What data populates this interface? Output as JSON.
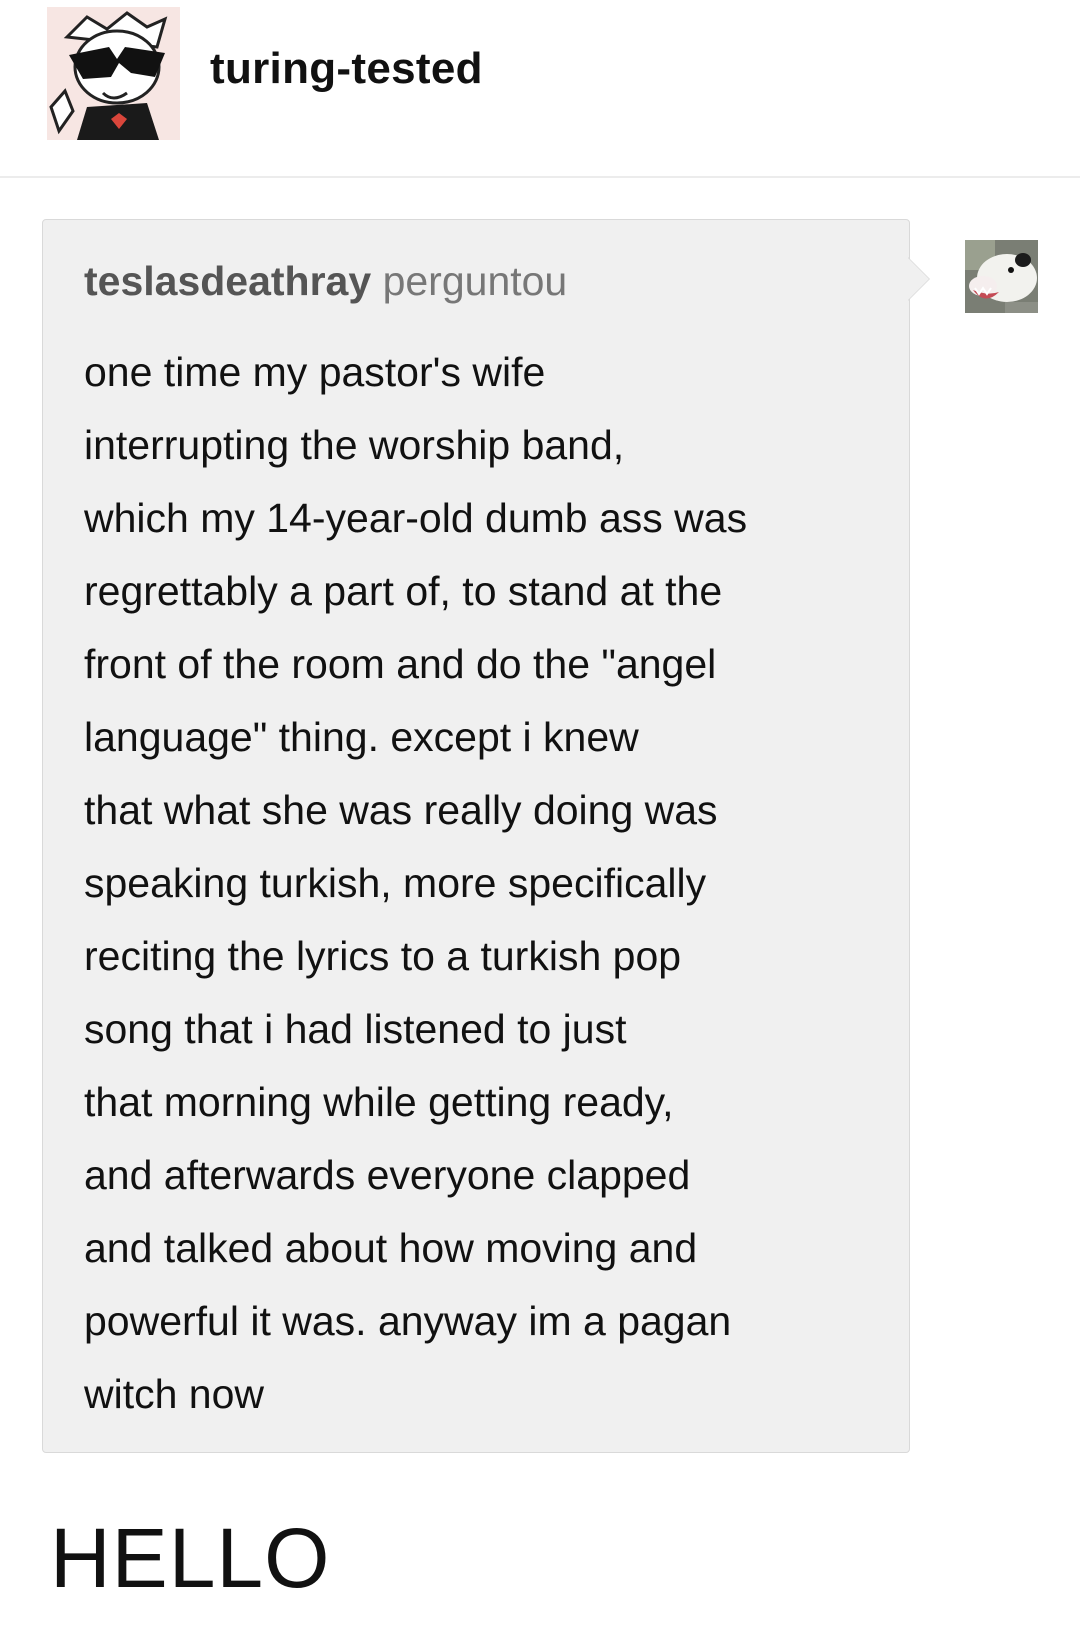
{
  "post": {
    "blog_name": "turing-tested"
  },
  "ask": {
    "asker": "teslasdeathray",
    "asked_word": "perguntou",
    "lines": [
      "one time my pastor's wife",
      "interrupting the worship band,",
      "which my 14-year-old dumb ass was",
      "regrettably a part of, to stand at the",
      "front of the room and do the \"angel",
      "language\" thing. except i knew",
      "that what she was really doing was",
      "speaking turkish, more specifically",
      "reciting the lyrics to a turkish pop",
      "song that i had listened to just",
      "that morning while getting ready,",
      "and afterwards everyone clapped",
      "and talked about how moving and",
      "powerful it was. anyway im a pagan",
      "witch now"
    ]
  },
  "answer": {
    "text": "HELLO"
  },
  "icons": {
    "blog_avatar": "cartoon-sunglasses-avatar",
    "asker_avatar": "opossum-avatar"
  }
}
